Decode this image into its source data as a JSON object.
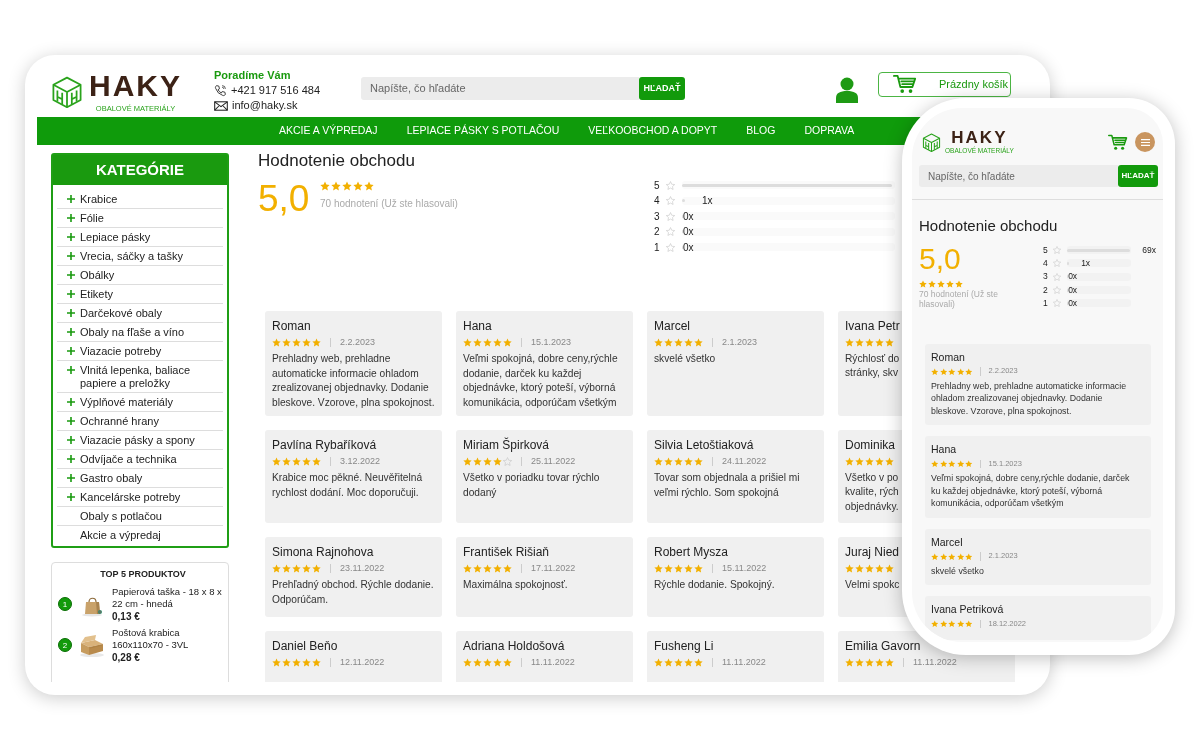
{
  "desktop": {
    "logo": {
      "name": "HAKY",
      "tagline": "OBALOVÉ MATERIÁLY"
    },
    "contact": {
      "heading": "Poradíme Vám",
      "phone": "+421 917 516 484",
      "email": "info@haky.sk"
    },
    "search": {
      "placeholder": "Napíšte, čo hľadáte",
      "button": "HĽADAŤ"
    },
    "cart": "Prázdny košík",
    "nav": [
      "AKCIE A VÝPREDAJ",
      "LEPIACE PÁSKY S POTLAČOU",
      "VEĽKOOBCHOD A DOPYT",
      "BLOG",
      "DOPRAVA"
    ],
    "categories": {
      "title": "KATEGÓRIE",
      "items": [
        {
          "label": "Krabice",
          "expandable": true
        },
        {
          "label": "Fólie",
          "expandable": true
        },
        {
          "label": "Lepiace pásky",
          "expandable": true
        },
        {
          "label": "Vrecia, sáčky a tašky",
          "expandable": true
        },
        {
          "label": "Obálky",
          "expandable": true
        },
        {
          "label": "Etikety",
          "expandable": true
        },
        {
          "label": "Darčekové obaly",
          "expandable": true
        },
        {
          "label": "Obaly na fľaše a víno",
          "expandable": true
        },
        {
          "label": "Viazacie potreby",
          "expandable": true
        },
        {
          "label": "Vlnitá lepenka, baliace papiere a preložky",
          "expandable": true
        },
        {
          "label": "Výplňové materiály",
          "expandable": true
        },
        {
          "label": "Ochranné hrany",
          "expandable": true
        },
        {
          "label": "Viazacie pásky a spony",
          "expandable": true
        },
        {
          "label": "Odvíjače a technika",
          "expandable": true
        },
        {
          "label": "Gastro obaly",
          "expandable": true
        },
        {
          "label": "Kancelárske potreby",
          "expandable": true
        },
        {
          "label": "Obaly s potlačou",
          "expandable": false
        },
        {
          "label": "Akcie a výpredaj",
          "expandable": false
        }
      ]
    },
    "top_products": {
      "title": "TOP 5 PRODUKTOV",
      "items": [
        {
          "rank": "1",
          "kind": "bag",
          "name": "Papierová taška - 18 x 8 x 22 cm - hnedá",
          "price": "0,13 €"
        },
        {
          "rank": "2",
          "kind": "box",
          "name": "Poštová krabica 160x110x70 - 3VL",
          "price": "0,28 €"
        }
      ]
    },
    "rating": {
      "title": "Hodnotenie obchodu",
      "score": "5,0",
      "stars": 5,
      "count_text": "70 hodnotení (Už ste hlasovali)",
      "distribution": [
        {
          "label": "5",
          "level": 0.986
        },
        {
          "label": "4",
          "level": 0.014,
          "count": "1x"
        },
        {
          "label": "3",
          "level": 0,
          "count": "0x"
        },
        {
          "label": "2",
          "level": 0,
          "count": "0x"
        },
        {
          "label": "1",
          "level": 0,
          "count": "0x"
        }
      ]
    },
    "reviews": [
      {
        "name": "Roman",
        "stars": 5,
        "date": "2.2.2023",
        "text": "Prehladny web, prehladne automaticke informacie ohladom zrealizovanej objednavky. Dodanie bleskove. Vzorove, plna spokojnost."
      },
      {
        "name": "Hana",
        "stars": 5,
        "date": "15.1.2023",
        "text": "Veľmi spokojná, dobre ceny,rýchle dodanie, darček ku každej objednávke, ktorý poteší, výborná komunikácia, odporúčam všetkým"
      },
      {
        "name": "Marcel",
        "stars": 5,
        "date": "2.1.2023",
        "text": "skvelé všetko"
      },
      {
        "name": "Ivana Petr",
        "stars": 5,
        "text": "Rýchlosť do\nstránky, skv"
      },
      {
        "name": "Pavlína Rybaříková",
        "stars": 5,
        "date": "3.12.2022",
        "text": "Krabice moc pěkné. Neuvěřitelná rychlost dodání. Moc doporučuji."
      },
      {
        "name": "Miriam Špirková",
        "stars": 4,
        "date": "25.11.2022",
        "text": "Všetko v poriadku tovar rýchlo dodaný"
      },
      {
        "name": "Silvia Letoštiaková",
        "stars": 5,
        "date": "24.11.2022",
        "text": "Tovar som objednala a prišiel mi veľmi rýchlo. Som spokojná"
      },
      {
        "name": "Dominika",
        "stars": 5,
        "text": "Všetko v po\nkvalite, rých\nobjednávky."
      },
      {
        "name": "Simona Rajnohova",
        "stars": 5,
        "date": "23.11.2022",
        "text": "Prehľadný obchod. Rýchle dodanie. Odporúčam."
      },
      {
        "name": "František Rišiaň",
        "stars": 5,
        "date": "17.11.2022",
        "text": "Maximálna spokojnosť."
      },
      {
        "name": "Robert Mysza",
        "stars": 5,
        "date": "15.11.2022",
        "text": "Rýchle dodanie. Spokojný."
      },
      {
        "name": "Juraj Nied",
        "stars": 5,
        "text": "Velmi spokc"
      },
      {
        "name": "Daniel Beňo",
        "stars": 5,
        "date": "12.11.2022"
      },
      {
        "name": "Adriana Holdošová",
        "stars": 5,
        "date": "11.11.2022"
      },
      {
        "name": "Fusheng Li",
        "stars": 5,
        "date": "11.11.2022"
      },
      {
        "name": "Emilia Gavorn",
        "stars": 5,
        "date": "11.11.2022"
      }
    ]
  },
  "mobile": {
    "logo": {
      "name": "HAKY",
      "tagline": "OBALOVÉ MATERIÁLY"
    },
    "search": {
      "placeholder": "Napíšte, čo hľadáte",
      "button": "HĽADAŤ"
    },
    "rating": {
      "title": "Hodnotenie obchodu",
      "score": "5,0",
      "stars": 5,
      "count_text": "70 hodnotení (Už ste hlasovali)",
      "distribution": [
        {
          "label": "5",
          "level": 0.986,
          "count": "69x"
        },
        {
          "label": "4",
          "level": 0.014,
          "count": "1x"
        },
        {
          "label": "3",
          "level": 0,
          "count": "0x"
        },
        {
          "label": "2",
          "level": 0,
          "count": "0x"
        },
        {
          "label": "1",
          "level": 0,
          "count": "0x"
        }
      ]
    },
    "reviews": [
      {
        "name": "Roman",
        "stars": 5,
        "date": "2.2.2023",
        "text": "Prehladny web, prehladne automaticke informacie ohladom zrealizovanej objednavky. Dodanie bleskove. Vzorove, plna spokojnost."
      },
      {
        "name": "Hana",
        "stars": 5,
        "date": "15.1.2023",
        "text": "Veľmi spokojná, dobre ceny,rýchle dodanie, darček ku každej objednávke, ktorý poteší, výborná komunikácia, odporúčam všetkým"
      },
      {
        "name": "Marcel",
        "stars": 5,
        "date": "2.1.2023",
        "text": "skvelé všetko"
      },
      {
        "name": "Ivana Petriková",
        "stars": 5,
        "date": "18.12.2022"
      }
    ]
  }
}
